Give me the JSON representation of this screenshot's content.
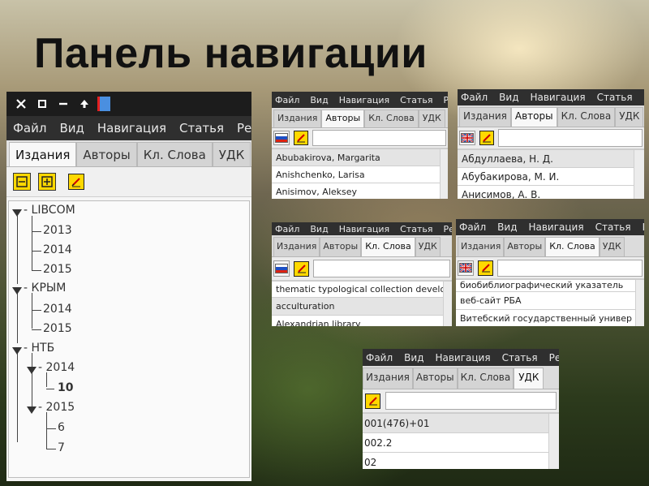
{
  "slide_title": "Панель навигации",
  "menu": [
    "Файл",
    "Вид",
    "Навигация",
    "Статья",
    "Ре"
  ],
  "tabs": [
    "Издания",
    "Авторы",
    "Кл. Слова",
    "УДК"
  ],
  "main_window": {
    "window_icons": [
      "close-icon",
      "maximize-icon",
      "minimize-icon",
      "arrow-up-icon"
    ],
    "active_tab": "Издания",
    "toolbar_icons": [
      "collapse-icon",
      "expand-icon",
      "pencil-icon"
    ],
    "tree": {
      "libcom": "LIBCOM",
      "libcom_years": [
        "2013",
        "2014",
        "2015"
      ],
      "krym": "КРЫМ",
      "krym_years": [
        "2014",
        "2015"
      ],
      "ntb": "НТБ",
      "ntb_2014": "2014",
      "ntb_2014_child": "10",
      "ntb_2015": "2015",
      "ntb_2015_children": [
        "6",
        "7"
      ]
    }
  },
  "panel_authors_latin": {
    "active_tab": "Авторы",
    "flag": "ru-flag-icon",
    "rows": [
      "Abubakirova, Margarita",
      "Anishchenko, Larisa",
      "Anisimov, Aleksey"
    ]
  },
  "panel_authors_cyrillic": {
    "active_tab": "Авторы",
    "flag": "gb-flag-icon",
    "rows": [
      "Абдуллаева, Н. Д.",
      "Абубакирова, М. И.",
      "Анисимов, А. В."
    ]
  },
  "panel_keywords_latin": {
    "active_tab": "Кл. Слова",
    "flag": "ru-flag-icon",
    "rows": [
      "thematic typological collection develop",
      "acculturation",
      "Alexandrian library"
    ]
  },
  "panel_keywords_cyrillic": {
    "active_tab": "Кл. Слова",
    "flag": "gb-flag-icon",
    "rows": [
      "биобиблиографический указатель",
      "веб-сайт РБА",
      "Витебский государственный универ"
    ]
  },
  "panel_udk": {
    "active_tab": "УДК",
    "rows": [
      "001(476)+01",
      "002.2",
      "02"
    ]
  },
  "colors": {
    "menubar": "#2f2f2f",
    "pencil_button": "#ffd800",
    "titlebar_accent": "#e52020",
    "titlebar_blue": "#4a8fe0"
  }
}
